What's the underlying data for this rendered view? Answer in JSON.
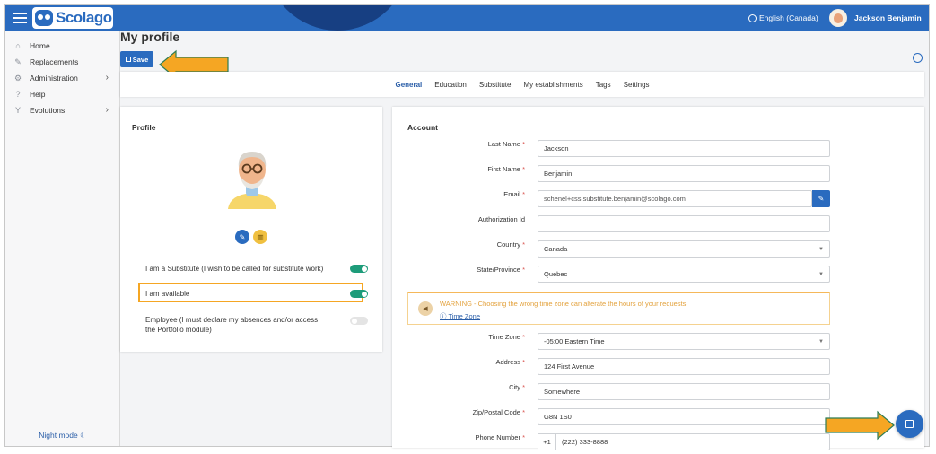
{
  "app": {
    "brand": "Scolago"
  },
  "header": {
    "language": "English (Canada)",
    "user_name": "Jackson Benjamin"
  },
  "sidebar": {
    "items": [
      {
        "label": "Home",
        "icon": "home-icon"
      },
      {
        "label": "Replacements",
        "icon": "replacements-icon"
      },
      {
        "label": "Administration",
        "icon": "gear-icon",
        "chevron": "›"
      },
      {
        "label": "Help",
        "icon": "help-icon"
      },
      {
        "label": "Evolutions",
        "icon": "evolutions-icon",
        "chevron": "›"
      }
    ],
    "night_mode": "Night mode ☾"
  },
  "page": {
    "title": "My profile",
    "save_label": "Save"
  },
  "tabs": [
    "General",
    "Education",
    "Substitute",
    "My establishments",
    "Tags",
    "Settings"
  ],
  "profile": {
    "title": "Profile",
    "toggles": [
      {
        "label": "I am a Substitute (I wish to be called for substitute work)",
        "on": true
      },
      {
        "label": "I am available",
        "on": true
      },
      {
        "label": "Employee (I must declare my absences and/or access the Portfolio module)",
        "on": false
      }
    ]
  },
  "account": {
    "title": "Account",
    "fields": {
      "last_name": {
        "label": "Last Name",
        "value": "Jackson"
      },
      "first_name": {
        "label": "First Name",
        "value": "Benjamin"
      },
      "email": {
        "label": "Email",
        "value": "schenel+css.substitute.benjamin@scolago.com"
      },
      "authorization_id": {
        "label": "Authorization Id",
        "value": ""
      },
      "country": {
        "label": "Country",
        "value": "Canada"
      },
      "state": {
        "label": "State/Province",
        "value": "Quebec"
      },
      "time_zone": {
        "label": "Time Zone",
        "value": "-05:00 Eastern Time"
      },
      "address": {
        "label": "Address",
        "value": "124 First Avenue"
      },
      "city": {
        "label": "City",
        "value": "Somewhere"
      },
      "zip": {
        "label": "Zip/Postal Code",
        "value": "G8N 1S0"
      },
      "phone": {
        "label": "Phone Number",
        "prefix": "+1",
        "value": "(222) 333-8888"
      }
    },
    "required_mark": "*",
    "warning": {
      "text": "WARNING - Choosing the wrong time zone can alterate the hours of your requests.",
      "link": "Time Zone"
    }
  },
  "colors": {
    "primary": "#2a6bbf",
    "toggle_on": "#1e9c7a",
    "highlight": "#f5a623"
  }
}
